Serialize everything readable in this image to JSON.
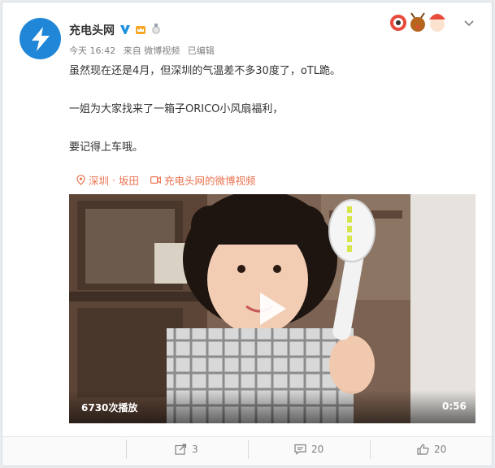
{
  "post": {
    "author": "充电头网",
    "meta": {
      "time": "今天 16:42",
      "source": "来自 微博视频",
      "edited": "已编辑"
    },
    "lines": [
      "虽然现在还是4月，但深圳的气温差不多30度了，oTL跪。",
      "一姐为大家找来了一箱子ORICO小风扇福利，",
      "要记得上车哦。"
    ],
    "location": {
      "city": "深圳",
      "sep": "·",
      "district": "坂田"
    },
    "video_source": "充电头网的微博视频",
    "video": {
      "plays": "6730次播放",
      "duration": "0:56"
    }
  },
  "actions": {
    "repost_count": "3",
    "comment_count": "20",
    "like_count": "20"
  },
  "colors": {
    "accent": "#eb7350",
    "verified": "#1a8fe0",
    "avatar": "#1f86d8"
  },
  "icons": [
    "lightning-icon",
    "verified-icon",
    "crown-icon",
    "medal-icon",
    "chevron-down-icon",
    "location-icon",
    "video-icon",
    "play-icon",
    "repost-icon",
    "comment-icon",
    "like-icon"
  ]
}
